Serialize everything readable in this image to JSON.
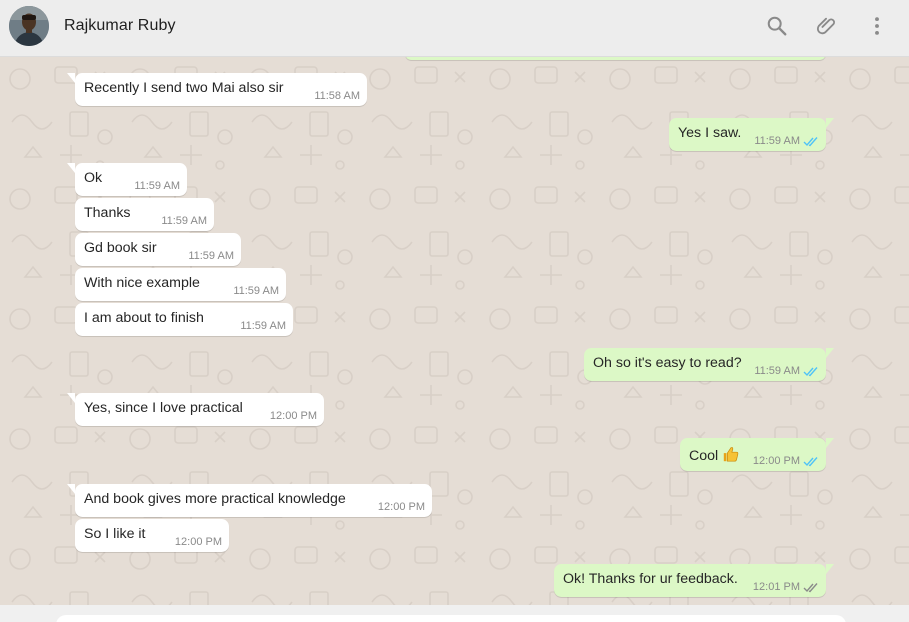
{
  "header": {
    "contact_name": "Rajkumar Ruby",
    "icons": [
      "search-icon",
      "attach-icon",
      "menu-icon"
    ]
  },
  "colors": {
    "incoming_bubble": "#ffffff",
    "outgoing_bubble": "#dcf8c6",
    "read_tick": "#4fc3f7",
    "delivered_tick": "#8a8a8a",
    "chat_background": "#e5ddd5"
  },
  "messages": [
    {
      "direction": "in",
      "text": "Recently I send two Mai also sir",
      "time": "11:58 AM"
    },
    {
      "direction": "out",
      "text": "Yes I saw.",
      "time": "11:59 AM",
      "status": "read"
    },
    {
      "direction": "in",
      "text": "Ok",
      "time": "11:59 AM"
    },
    {
      "direction": "in",
      "text": "Thanks",
      "time": "11:59 AM"
    },
    {
      "direction": "in",
      "text": "Gd book sir",
      "time": "11:59 AM"
    },
    {
      "direction": "in",
      "text": "With nice example",
      "time": "11:59 AM"
    },
    {
      "direction": "in",
      "text": "I am about to finish",
      "time": "11:59 AM"
    },
    {
      "direction": "out",
      "text": "Oh so it's easy to read?",
      "time": "11:59 AM",
      "status": "read"
    },
    {
      "direction": "in",
      "text": "Yes, since I love practical",
      "time": "12:00 PM"
    },
    {
      "direction": "out",
      "text": "Cool",
      "emoji": "thumbs-up",
      "time": "12:00 PM",
      "status": "read"
    },
    {
      "direction": "in",
      "text": "And book gives more practical knowledge",
      "time": "12:00 PM"
    },
    {
      "direction": "in",
      "text": "So I like it",
      "time": "12:00 PM"
    },
    {
      "direction": "out",
      "text": "Ok! Thanks for ur feedback.",
      "time": "12:01 PM",
      "status": "delivered"
    }
  ]
}
